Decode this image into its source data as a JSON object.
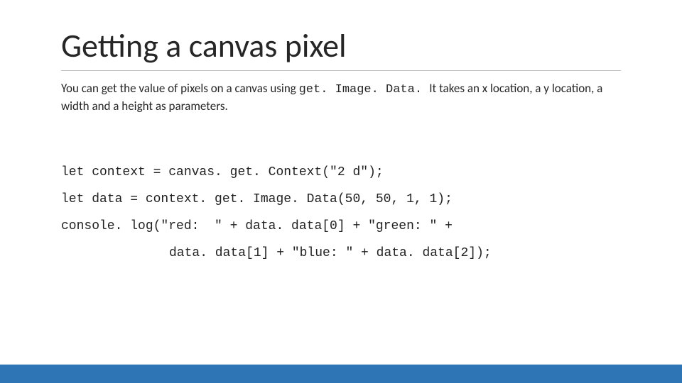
{
  "title": "Getting a canvas pixel",
  "body": {
    "part1": "You can get the value of pixels on a canvas using ",
    "mono": "get. Image. Data. ",
    "part2": "It takes an x location, a y location, a width and a height as parameters."
  },
  "code": {
    "l1": "let context = canvas. get. Context(\"2 d\");",
    "l2": "let data = context. get. Image. Data(50, 50, 1, 1);",
    "l3": "console. log(\"red:  \" + data. data[0] + \"green: \" +",
    "l4": "data. data[1] + \"blue: \" + data. data[2]);"
  }
}
